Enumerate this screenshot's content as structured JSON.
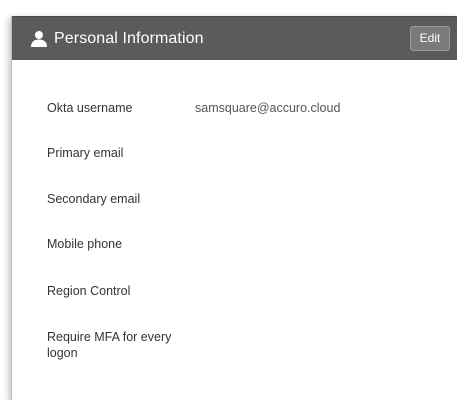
{
  "header": {
    "title": "Personal Information",
    "edit_label": "Edit",
    "icon": "person-icon"
  },
  "fields": [
    {
      "label": "Okta username",
      "value": "samsquare@accuro.cloud"
    },
    {
      "label": "Primary email",
      "value": ""
    },
    {
      "label": "Secondary email",
      "value": ""
    },
    {
      "label": "Mobile phone",
      "value": ""
    },
    {
      "label": "Region Control",
      "value": ""
    },
    {
      "label": "Require MFA for every logon",
      "value": ""
    }
  ],
  "colors": {
    "header_bg": "#5b5b5b",
    "edit_bg": "#7a7a7a",
    "label_text": "#333333",
    "value_text": "#555555"
  }
}
